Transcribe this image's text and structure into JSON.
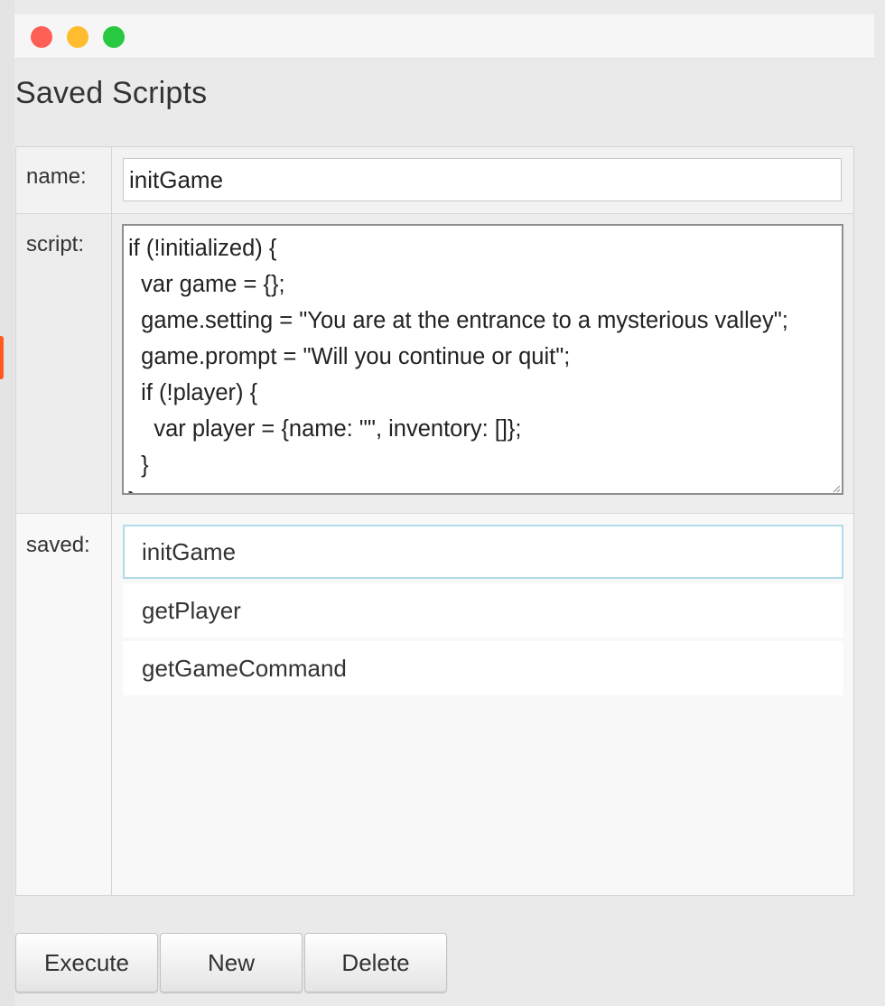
{
  "window": {
    "controls": [
      "close",
      "minimize",
      "maximize"
    ],
    "colors": {
      "close": "#fe5f57",
      "minimize": "#febc2e",
      "maximize": "#28c840"
    }
  },
  "page": {
    "title": "Saved Scripts"
  },
  "form": {
    "name_label": "name:",
    "name_value": "initGame",
    "script_label": "script:",
    "script_value": "if (!initialized) {\n  var game = {};\n  game.setting = \"You are at the entrance to a mysterious valley\";\n  game.prompt = \"Will you continue or quit\";\n  if (!player) {\n    var player = {name: \"\", inventory: []};\n  }\n}",
    "saved_label": "saved:"
  },
  "saved_list": {
    "selected_index": 0,
    "items": [
      {
        "label": "initGame"
      },
      {
        "label": "getPlayer"
      },
      {
        "label": "getGameCommand"
      }
    ]
  },
  "buttons": {
    "execute": "Execute",
    "new": "New",
    "delete": "Delete"
  }
}
